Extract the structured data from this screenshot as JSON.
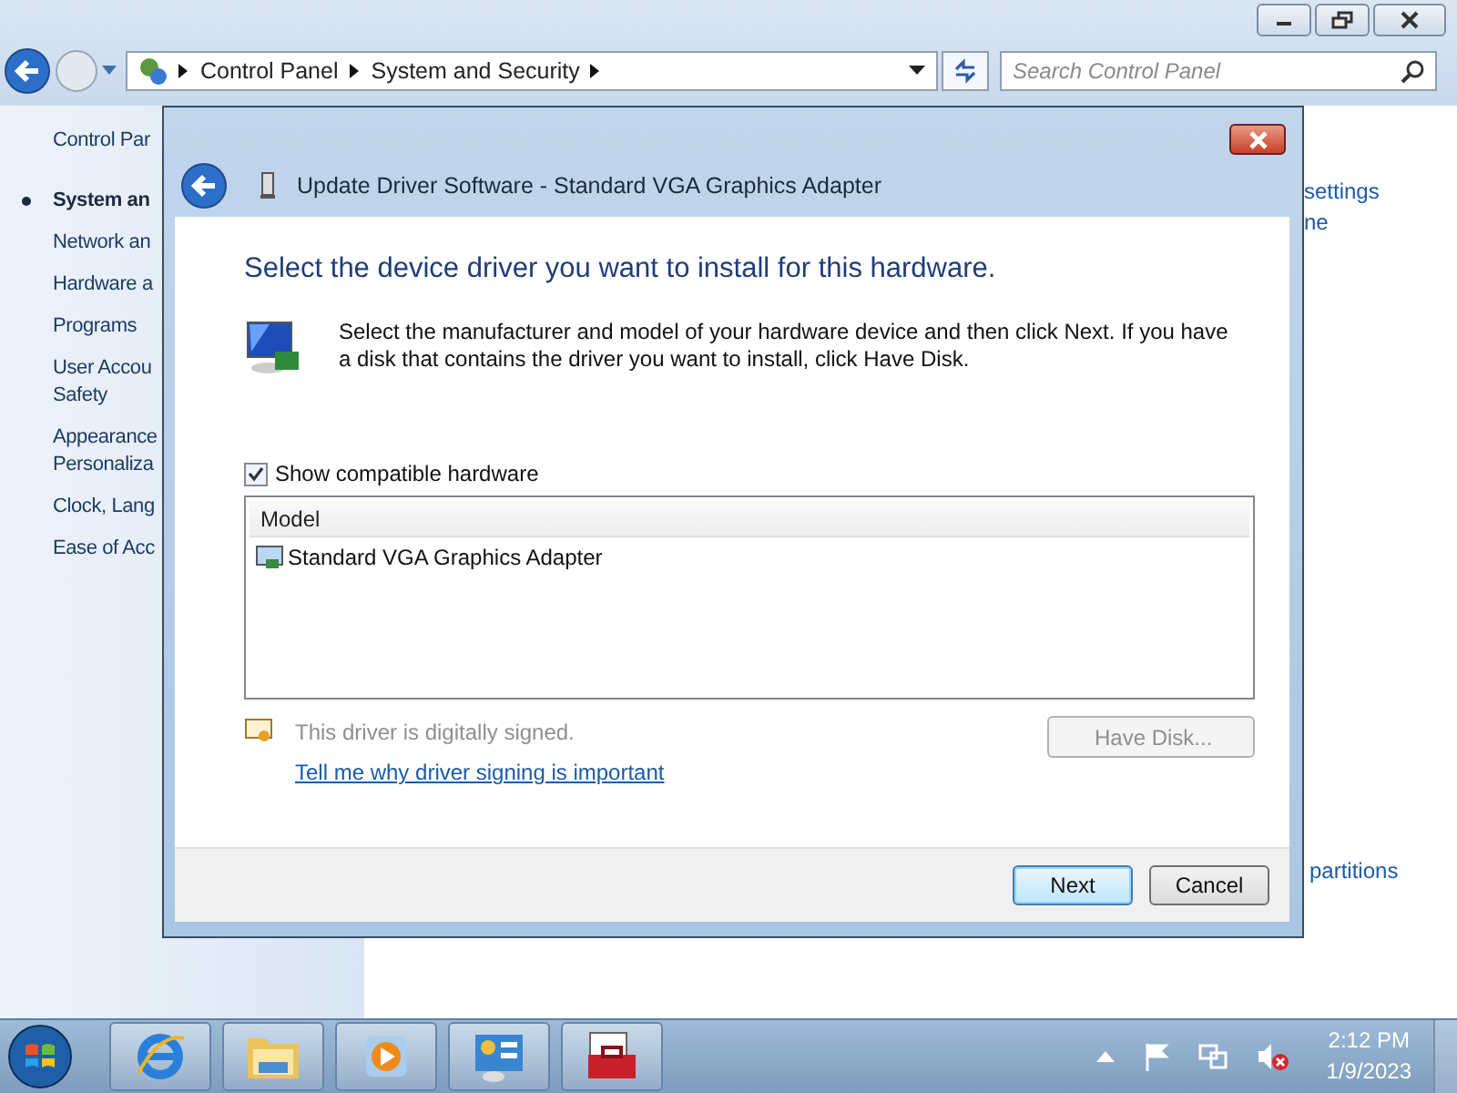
{
  "address_bar": {
    "breadcrumbs": [
      "Control Panel",
      "System and Security"
    ],
    "search": {
      "placeholder": "Search Control Panel"
    }
  },
  "sidebar": {
    "items": [
      {
        "lines": [
          "Control Par"
        ],
        "selected": false
      },
      {
        "lines": [
          "System an"
        ],
        "selected": true
      },
      {
        "lines": [
          "Network an"
        ],
        "selected": false
      },
      {
        "lines": [
          "Hardware a"
        ],
        "selected": false
      },
      {
        "lines": [
          "Programs"
        ],
        "selected": false
      },
      {
        "lines": [
          "User Accou",
          "Safety"
        ],
        "selected": false
      },
      {
        "lines": [
          "Appearance",
          "Personaliza"
        ],
        "selected": false
      },
      {
        "lines": [
          "Clock, Lang"
        ],
        "selected": false
      },
      {
        "lines": [
          "Ease of Acc"
        ],
        "selected": false
      }
    ]
  },
  "right_links": [
    "settings",
    "ne",
    "partitions"
  ],
  "dialog": {
    "title": "Update Driver Software - Standard VGA Graphics Adapter",
    "heading": "Select the device driver you want to install for this hardware.",
    "instruction": "Select the manufacturer and model of your hardware device and then click Next. If you have a disk that contains the driver you want to install, click Have Disk.",
    "show_compatible": {
      "label": "Show compatible hardware",
      "checked": true
    },
    "list": {
      "column": "Model",
      "rows": [
        {
          "label": "Standard VGA Graphics Adapter",
          "selected": false
        }
      ]
    },
    "signed_text": "This driver is digitally signed.",
    "signing_link": "Tell me why driver signing is important",
    "have_disk": {
      "label": "Have Disk...",
      "disabled": true
    },
    "buttons": [
      {
        "label": "Next",
        "default": true
      },
      {
        "label": "Cancel",
        "default": false
      }
    ]
  },
  "taskbar": {
    "items": [
      {
        "kind": "browser"
      },
      {
        "kind": "folder"
      },
      {
        "kind": "media"
      },
      {
        "kind": "panel"
      },
      {
        "kind": "toolbox"
      }
    ],
    "clock": {
      "time": "2:12 PM",
      "date": "1/9/2023"
    }
  }
}
